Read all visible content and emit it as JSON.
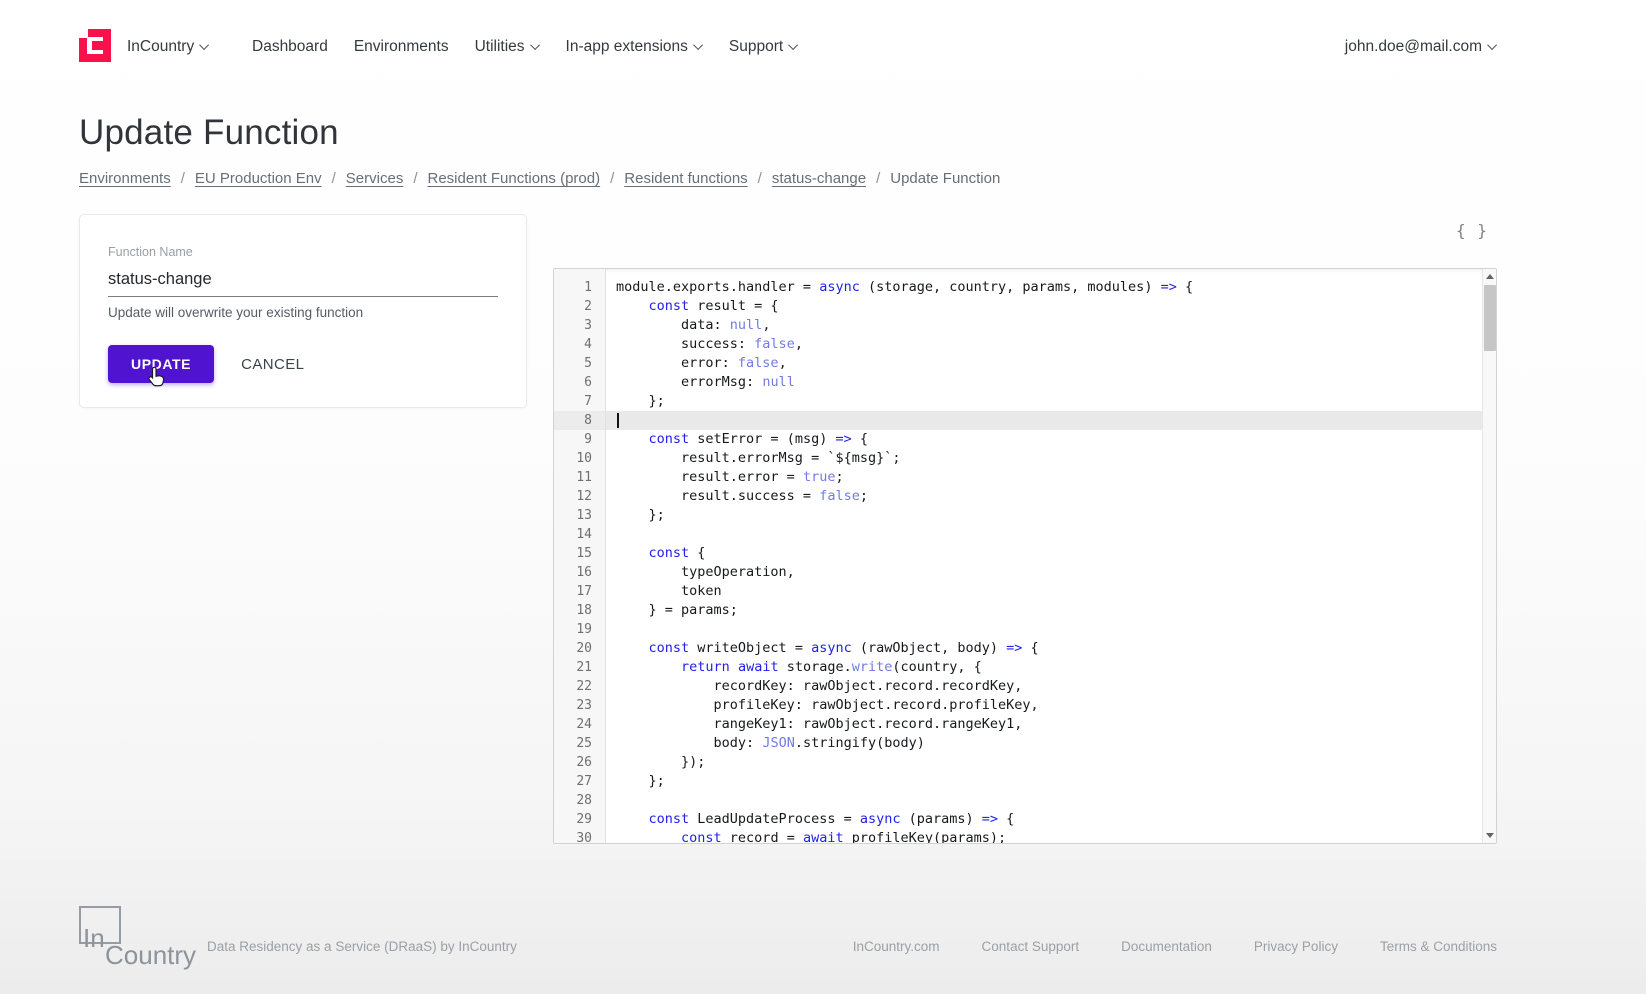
{
  "colors": {
    "brand_pink": "#F9114B",
    "button_purple": "#5014D0",
    "code_keyword_blue": "#2121E8",
    "code_atom_blue": "#727BE4",
    "active_line_gray": "#E9E9E9"
  },
  "header": {
    "brand": "InCountry",
    "brand_has_caret": true,
    "nav": [
      {
        "label": "Dashboard",
        "has_caret": false
      },
      {
        "label": "Environments",
        "has_caret": false
      },
      {
        "label": "Utilities",
        "has_caret": true
      },
      {
        "label": "In-app extensions",
        "has_caret": true
      },
      {
        "label": "Support",
        "has_caret": true
      }
    ],
    "user_email": "john.doe@mail.com"
  },
  "page": {
    "title": "Update Function",
    "breadcrumb_separator": "/",
    "breadcrumbs": [
      {
        "label": "Environments",
        "link": true
      },
      {
        "label": "EU Production Env",
        "link": true
      },
      {
        "label": "Services",
        "link": true
      },
      {
        "label": "Resident Functions (prod)",
        "link": true
      },
      {
        "label": "Resident functions",
        "link": true
      },
      {
        "label": "status-change",
        "link": true
      },
      {
        "label": "Update Function",
        "link": false
      }
    ]
  },
  "form": {
    "field_label": "Function Name",
    "field_value": "status-change",
    "helper_text": "Update will overwrite your existing function",
    "update_label": "UPDATE",
    "cancel_label": "CANCEL"
  },
  "editor": {
    "format_button": "{ }",
    "active_line": 8,
    "lines": [
      [
        [
          "d",
          "module.exports.handler = "
        ],
        [
          "k",
          "async"
        ],
        [
          "d",
          " (storage, country, params, modules) "
        ],
        [
          "k",
          "=>"
        ],
        [
          "d",
          " {"
        ]
      ],
      [
        [
          "d",
          "    "
        ],
        [
          "k",
          "const"
        ],
        [
          "d",
          " result = {"
        ]
      ],
      [
        [
          "d",
          "        data: "
        ],
        [
          "a",
          "null"
        ],
        [
          "d",
          ","
        ]
      ],
      [
        [
          "d",
          "        success: "
        ],
        [
          "a",
          "false"
        ],
        [
          "d",
          ","
        ]
      ],
      [
        [
          "d",
          "        error: "
        ],
        [
          "a",
          "false"
        ],
        [
          "d",
          ","
        ]
      ],
      [
        [
          "d",
          "        errorMsg: "
        ],
        [
          "a",
          "null"
        ]
      ],
      [
        [
          "d",
          "    };"
        ]
      ],
      [],
      [
        [
          "d",
          "    "
        ],
        [
          "k",
          "const"
        ],
        [
          "d",
          " setError = (msg) "
        ],
        [
          "k",
          "=>"
        ],
        [
          "d",
          " {"
        ]
      ],
      [
        [
          "d",
          "        result.errorMsg = `${msg}`;"
        ]
      ],
      [
        [
          "d",
          "        result.error = "
        ],
        [
          "a",
          "true"
        ],
        [
          "d",
          ";"
        ]
      ],
      [
        [
          "d",
          "        result.success = "
        ],
        [
          "a",
          "false"
        ],
        [
          "d",
          ";"
        ]
      ],
      [
        [
          "d",
          "    };"
        ]
      ],
      [],
      [
        [
          "d",
          "    "
        ],
        [
          "k",
          "const"
        ],
        [
          "d",
          " {"
        ]
      ],
      [
        [
          "d",
          "        typeOperation,"
        ]
      ],
      [
        [
          "d",
          "        token"
        ]
      ],
      [
        [
          "d",
          "    } = params;"
        ]
      ],
      [],
      [
        [
          "d",
          "    "
        ],
        [
          "k",
          "const"
        ],
        [
          "d",
          " writeObject = "
        ],
        [
          "k",
          "async"
        ],
        [
          "d",
          " (rawObject, body) "
        ],
        [
          "k",
          "=>"
        ],
        [
          "d",
          " {"
        ]
      ],
      [
        [
          "d",
          "        "
        ],
        [
          "k",
          "return"
        ],
        [
          "d",
          " "
        ],
        [
          "k",
          "await"
        ],
        [
          "d",
          " storage."
        ],
        [
          "a",
          "write"
        ],
        [
          "d",
          "(country, {"
        ]
      ],
      [
        [
          "d",
          "            recordKey: rawObject.record.recordKey,"
        ]
      ],
      [
        [
          "d",
          "            profileKey: rawObject.record.profileKey,"
        ]
      ],
      [
        [
          "d",
          "            rangeKey1: rawObject.record.rangeKey1,"
        ]
      ],
      [
        [
          "d",
          "            body: "
        ],
        [
          "a",
          "JSON"
        ],
        [
          "d",
          ".stringify(body)"
        ]
      ],
      [
        [
          "d",
          "        });"
        ]
      ],
      [
        [
          "d",
          "    };"
        ]
      ],
      [],
      [
        [
          "d",
          "    "
        ],
        [
          "k",
          "const"
        ],
        [
          "d",
          " LeadUpdateProcess = "
        ],
        [
          "k",
          "async"
        ],
        [
          "d",
          " (params) "
        ],
        [
          "k",
          "=>"
        ],
        [
          "d",
          " {"
        ]
      ],
      [
        [
          "d",
          "        "
        ],
        [
          "k",
          "const"
        ],
        [
          "d",
          " record = "
        ],
        [
          "k",
          "await"
        ],
        [
          "d",
          " profileKey(params);"
        ]
      ]
    ]
  },
  "footer": {
    "logo_top": "In",
    "logo_bottom": "Country",
    "slogan": "Data Residency as a Service (DRaaS) by InCountry",
    "links": [
      "InCountry.com",
      "Contact Support",
      "Documentation",
      "Privacy Policy",
      "Terms & Conditions"
    ]
  }
}
